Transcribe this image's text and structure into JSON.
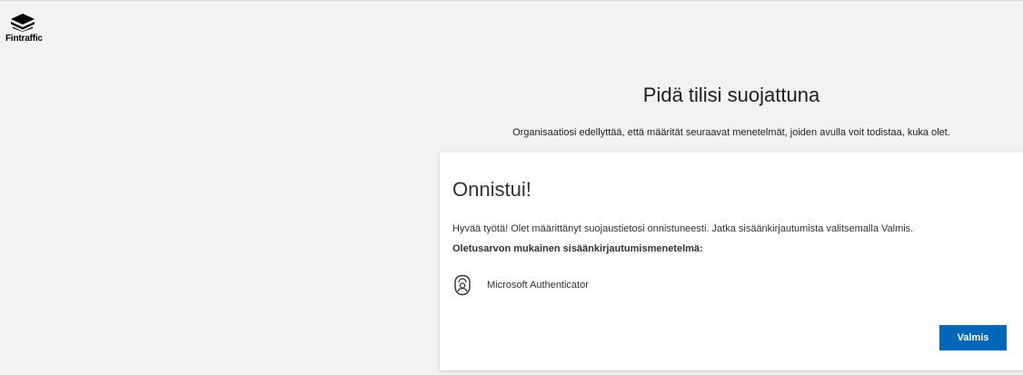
{
  "header": {
    "logo_text": "Fintraffic",
    "logo_icon": "fintraffic-logo-icon"
  },
  "main": {
    "title": "Pidä tilisi suojattuna",
    "subtitle": "Organisaatiosi edellyttää, että määrität seuraavat menetelmät, joiden avulla voit todistaa, kuka olet."
  },
  "card": {
    "title": "Onnistui!",
    "message": "Hyvää työtä! Olet määrittänyt suojaustietosi onnistuneesti. Jatka sisäänkirjautumista valitsemalla Valmis.",
    "default_method_label": "Oletusarvon mukainen sisäänkirjautumismenetelmä:",
    "method": {
      "icon": "authenticator-lock-icon",
      "label": "Microsoft Authenticator"
    },
    "done_button_label": "Valmis"
  },
  "colors": {
    "accent": "#0067b8",
    "background": "#f3f2f1",
    "card": "#ffffff",
    "text": "#323130"
  }
}
